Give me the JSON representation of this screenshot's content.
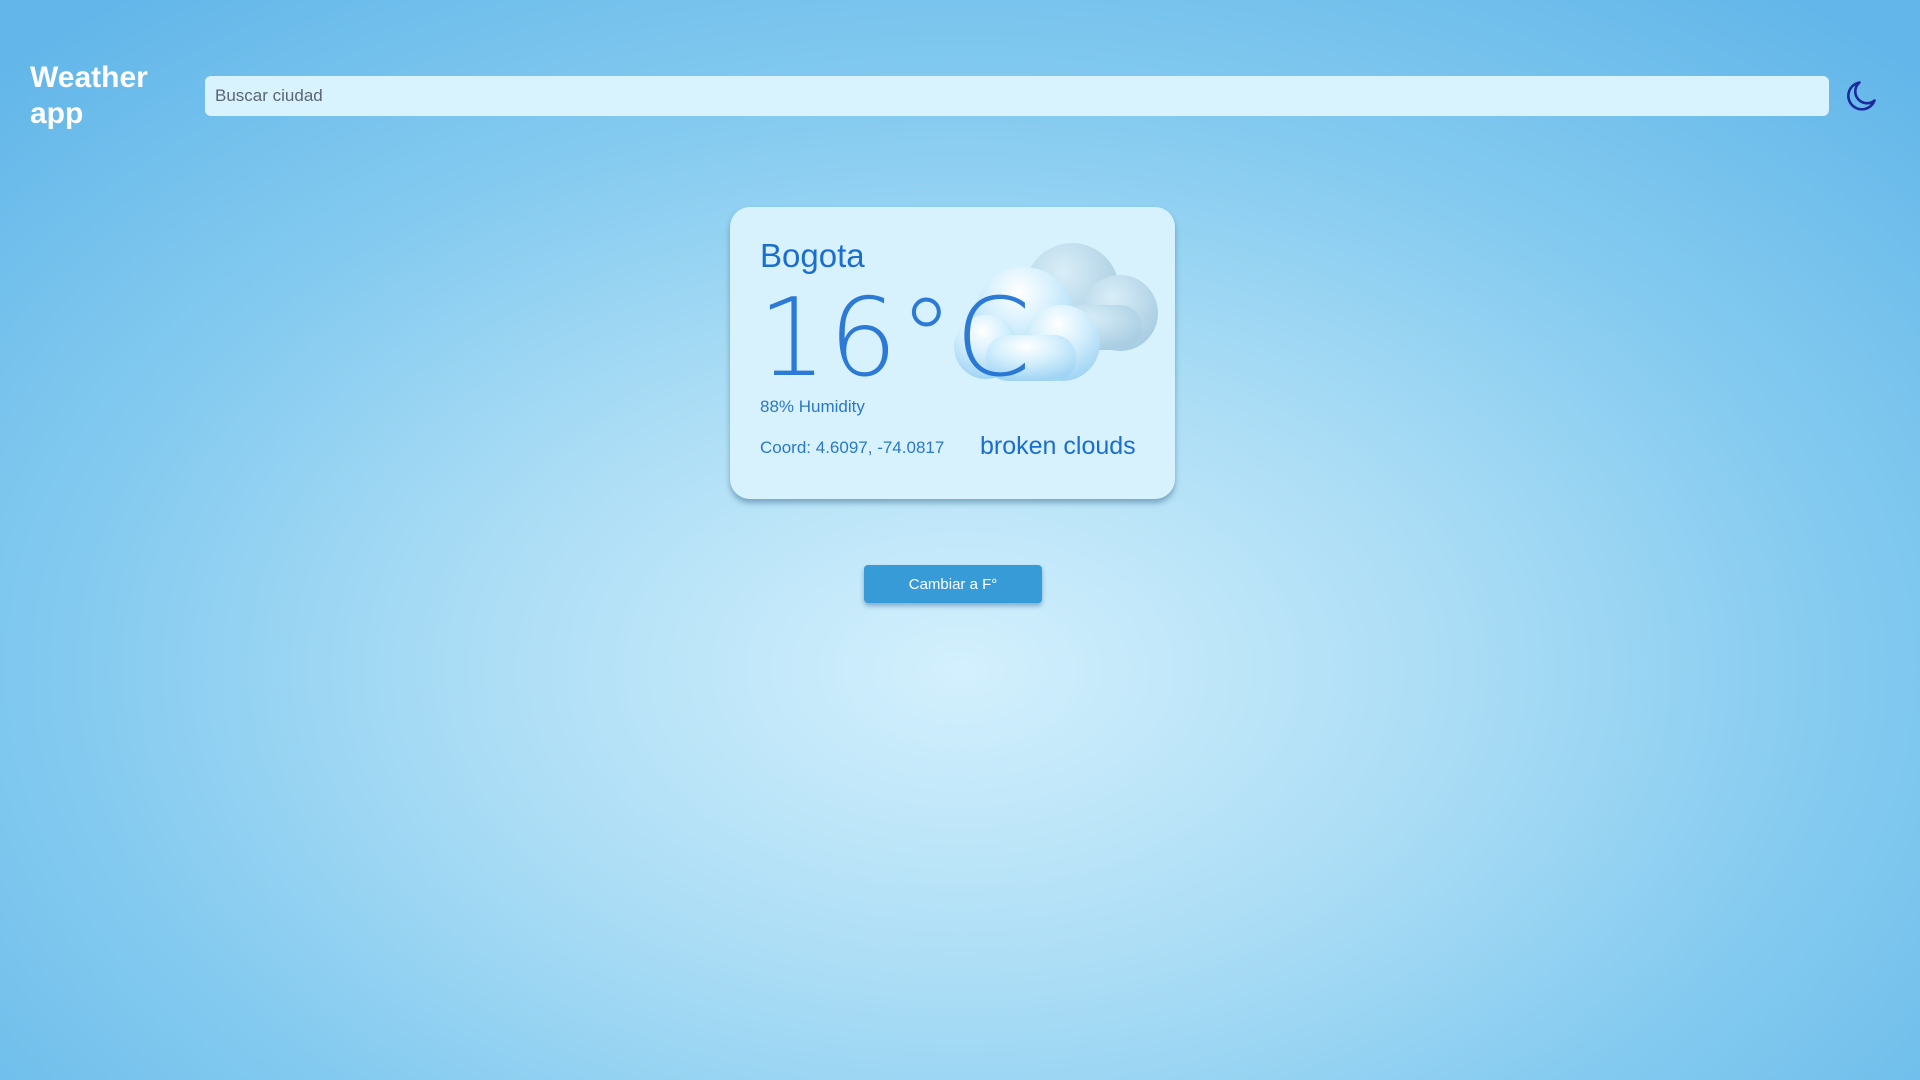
{
  "header": {
    "app_title": "Weather app",
    "search": {
      "placeholder": "Buscar ciudad",
      "value": ""
    },
    "theme_toggle_icon": "moon-icon"
  },
  "weather": {
    "city": "Bogota",
    "temperature": "16°C",
    "humidity": "88% Humidity",
    "coord": "Coord: 4.6097, -74.0817",
    "description": "broken clouds",
    "icon": "broken-clouds-icon"
  },
  "unit_toggle": {
    "label": "Cambiar a F°"
  },
  "colors": {
    "accent_text": "#1a6ed1",
    "card_background": "#d8f2fd",
    "button_background": "#379bd8",
    "moon_icon": "#1d2a9c"
  }
}
